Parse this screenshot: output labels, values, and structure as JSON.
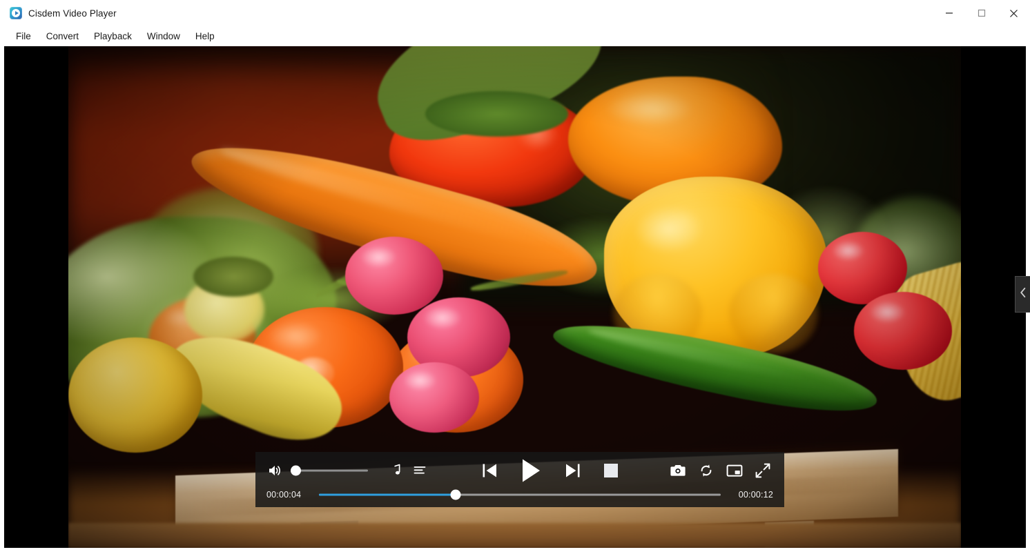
{
  "window": {
    "title": "Cisdem Video Player",
    "app_icon": "play-badge-icon",
    "controls": {
      "minimize": "minimize-icon",
      "maximize": "maximize-icon",
      "close": "close-icon"
    }
  },
  "menubar": {
    "items": [
      {
        "label": "File"
      },
      {
        "label": "Convert"
      },
      {
        "label": "Playback"
      },
      {
        "label": "Window"
      },
      {
        "label": "Help"
      }
    ]
  },
  "player": {
    "volume": {
      "icon": "volume-icon",
      "level_percent": 2
    },
    "audio_track_icon": "music-note-icon",
    "subtitle_icon": "subtitle-list-icon",
    "transport": {
      "previous_icon": "previous-track-icon",
      "play_icon": "play-icon",
      "next_icon": "next-track-icon",
      "stop_icon": "stop-icon"
    },
    "tools": {
      "snapshot_icon": "camera-icon",
      "loop_icon": "repeat-icon",
      "pip_icon": "picture-in-picture-icon",
      "fullscreen_icon": "expand-icon"
    },
    "timeline": {
      "current_time": "00:00:04",
      "total_time": "00:00:12",
      "progress_percent": 34
    },
    "accent_color": "#2f9fe0",
    "control_bar_color": "#161616"
  },
  "side_panel": {
    "toggle_icon": "chevron-left-icon"
  },
  "video": {
    "description": "close-up of fresh vegetables on a wooden cutting board"
  }
}
